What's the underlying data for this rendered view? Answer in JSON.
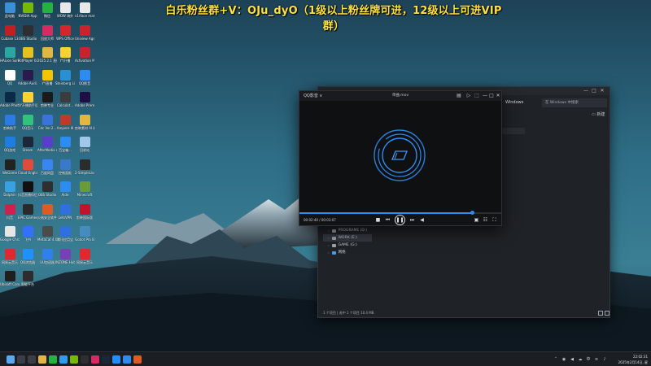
{
  "banner": {
    "text": "白乐粉丝群+V：OJu_dyO（1级以上粉丝牌可进，12级以上可进VIP群）"
  },
  "desktop": {
    "icons": [
      {
        "label": "此电脑",
        "icon": "computer-icon",
        "color": "#3b8ed8"
      },
      {
        "label": "NVIDIA App",
        "icon": "nvidia-icon",
        "color": "#76b900"
      },
      {
        "label": "微信",
        "icon": "wechat-icon",
        "color": "#24b33f"
      },
      {
        "label": "WOW 海外",
        "icon": "file-icon",
        "color": "#e8e8e8"
      },
      {
        "label": "v1rface makeup(1)...",
        "icon": "file-icon",
        "color": "#e8e8e8"
      },
      {
        "label": "Cubase 13",
        "icon": "cubase-icon",
        "color": "#c41e25"
      },
      {
        "label": "OBS Studio",
        "icon": "obs-icon",
        "color": "#302e31"
      },
      {
        "label": "回放大师",
        "icon": "replay-icon",
        "color": "#d62b62"
      },
      {
        "label": "WPS Office",
        "icon": "wps-icon",
        "color": "#d6262c"
      },
      {
        "label": "Uniview Agent 12.6",
        "icon": "uniview-icon",
        "color": "#c9242b"
      },
      {
        "label": "HALion Sonic",
        "icon": "halion-icon",
        "color": "#2ea6a0"
      },
      {
        "label": "PotPlayer 64 bit",
        "icon": "potplayer-icon",
        "color": "#e6c11c"
      },
      {
        "label": "2025.2.1 直播",
        "icon": "folder-icon",
        "color": "#e3b63f"
      },
      {
        "label": "YY开播",
        "icon": "yy-icon",
        "color": "#ffd230"
      },
      {
        "label": "Activation Manager",
        "icon": "activation-icon",
        "color": "#c8232c"
      },
      {
        "label": "QQ",
        "icon": "qq-icon",
        "color": "#ffffff"
      },
      {
        "label": "Adobe Audi...",
        "icon": "audition-icon",
        "color": "#2b1a4d"
      },
      {
        "label": "YY直播",
        "icon": "yy-live-icon",
        "color": "#f5c400"
      },
      {
        "label": "Steinberg Library ...",
        "icon": "steinberg-icon",
        "color": "#2b8fd3"
      },
      {
        "label": "QQ影音",
        "icon": "qq-player-icon",
        "color": "#2d8cf0"
      },
      {
        "label": "Adobe Photosh...",
        "icon": "photoshop-icon",
        "color": "#0b2a4a"
      },
      {
        "label": "YY开播助手设置",
        "icon": "yy-icon",
        "color": "#ffd230"
      },
      {
        "label": "剪映专业",
        "icon": "capcut-icon",
        "color": "#1a1a1a"
      },
      {
        "label": "Calculat...",
        "icon": "calculator-icon",
        "color": "#3c3c3c"
      },
      {
        "label": "Adobe Premie...",
        "icon": "premiere-icon",
        "color": "#1e1042"
      },
      {
        "label": "剪映助手",
        "icon": "kuaishou-icon",
        "color": "#2c7be5"
      },
      {
        "label": "QQ音乐",
        "icon": "qqmusic-icon",
        "color": "#31c27c"
      },
      {
        "label": "Cdc Ver.2...",
        "icon": "cdc-icon",
        "color": "#3a73d9"
      },
      {
        "label": "Ampere III",
        "icon": "ampere-icon",
        "color": "#c0392b"
      },
      {
        "label": "剪映素材 AI 精剪完成",
        "icon": "folder-icon",
        "color": "#e3b63f"
      },
      {
        "label": "QQ游戏",
        "icon": "qqgame-icon",
        "color": "#1f7de0"
      },
      {
        "label": "Steam",
        "icon": "steam-icon",
        "color": "#1b2838"
      },
      {
        "label": "AfterMedia AI Lan...",
        "icon": "aftermedia-icon",
        "color": "#5b3ec8"
      },
      {
        "label": "百宝箱...",
        "icon": "baobao-icon",
        "color": "#2d8cf0"
      },
      {
        "label": "回收站",
        "icon": "recycle-bin-icon",
        "color": "#9ec7ea"
      },
      {
        "label": "WeGame",
        "icon": "wegame-icon",
        "color": "#222222"
      },
      {
        "label": "Cloud English",
        "icon": "cloud-english-icon",
        "color": "#e04b3b"
      },
      {
        "label": "百度网盘",
        "icon": "baidu-netdisk-icon",
        "color": "#3a86f0"
      },
      {
        "label": "控制面板",
        "icon": "control-panel-icon",
        "color": "#3a78c9"
      },
      {
        "label": "2-SimpleLive",
        "icon": "simplelive-icon",
        "color": "#2c2c2c"
      },
      {
        "label": "Dolphin",
        "icon": "dolphin-icon",
        "color": "#3aa0e0"
      },
      {
        "label": "抖音直播伴侣",
        "icon": "douyin-icon",
        "color": "#111111"
      },
      {
        "label": "OBS Studio",
        "icon": "obs-icon",
        "color": "#302e31"
      },
      {
        "label": "Aide",
        "icon": "aide-icon",
        "color": "#2d8cf0"
      },
      {
        "label": "Minecraft",
        "icon": "minecraft-icon",
        "color": "#6a9b3b"
      },
      {
        "label": "抖音",
        "icon": "douyin-icon",
        "color": "#d02050"
      },
      {
        "label": "EPIC Games Launcher",
        "icon": "epic-icon",
        "color": "#2a2a2a"
      },
      {
        "label": "火绒安全软件",
        "icon": "huorong-icon",
        "color": "#e05a23"
      },
      {
        "label": "LetsVPN",
        "icon": "letsvpn-icon",
        "color": "#2f6fe0"
      },
      {
        "label": "剪映国际版",
        "icon": "capcut-icon",
        "color": "#c0142a"
      },
      {
        "label": "Google Chrome",
        "icon": "chrome-icon",
        "color": "#e6e6e6"
      },
      {
        "label": "飞书",
        "icon": "feishu-icon",
        "color": "#3370ff"
      },
      {
        "label": "MetaCat 4.0",
        "icon": "metacat-icon",
        "color": "#4b4b4b"
      },
      {
        "label": "腾讯应用宝",
        "icon": "tencent-icon",
        "color": "#2f6fe0"
      },
      {
        "label": "Godot Pro B",
        "icon": "godot-icon",
        "color": "#478cbf"
      },
      {
        "label": "网易云音乐",
        "icon": "neteasemusic-icon",
        "color": "#e0292c"
      },
      {
        "label": "QQ浏览器",
        "icon": "qqbrowser-icon",
        "color": "#1e90ff"
      },
      {
        "label": "UU加速器",
        "icon": "uu-icon",
        "color": "#2f80ed"
      },
      {
        "label": "INZONE Hub",
        "icon": "inzone-icon",
        "color": "#7b3fb5"
      },
      {
        "label": "网易云音乐",
        "icon": "neteasemusic-icon",
        "color": "#e0292c"
      },
      {
        "label": "Ubisoft Connect",
        "icon": "ubisoft-icon",
        "color": "#1f1f1f"
      },
      {
        "label": "智能平台",
        "icon": "platform-icon",
        "color": "#2d2d2d"
      }
    ]
  },
  "file_manager": {
    "address": "Windows",
    "search_placeholder": "在 Windows 中搜索",
    "new_folder": "新建",
    "drives": [
      {
        "label": "PROGRAME (D:)",
        "selected": false
      },
      {
        "label": "WORK (E:)",
        "selected": true
      },
      {
        "label": "GAME (G:)",
        "selected": false
      },
      {
        "label": "网络",
        "selected": false
      }
    ],
    "status": "1 个项目 | 选中 1 个项目  10.4 MB"
  },
  "player": {
    "app_name": "QQ影音 ∨",
    "file_name": "单曲.mov",
    "time": "00:02:40 / 00:03:07",
    "progress": 0.8556,
    "accent": "#2d8cf0"
  },
  "taskbar": {
    "time": "22:02:31",
    "date": "2025年2月14日, 星期五",
    "icons": [
      {
        "name": "start-icon",
        "color": "#5aa9f0"
      },
      {
        "name": "search-icon",
        "color": "#3b3f45"
      },
      {
        "name": "taskview-icon",
        "color": "#3b3f45"
      },
      {
        "name": "file-explorer-icon",
        "color": "#e3b63f"
      },
      {
        "name": "wechat-icon",
        "color": "#24b33f"
      },
      {
        "name": "qq-icon",
        "color": "#2c9cf0"
      },
      {
        "name": "nvidia-icon",
        "color": "#76b900"
      },
      {
        "name": "obs-icon",
        "color": "#302e31"
      },
      {
        "name": "replay-icon",
        "color": "#d62b62"
      },
      {
        "name": "steam-icon",
        "color": "#1b2838"
      },
      {
        "name": "qqbrowser-icon",
        "color": "#1e90ff"
      },
      {
        "name": "qq-player-icon",
        "color": "#2d8cf0"
      },
      {
        "name": "app-icon",
        "color": "#e05a23"
      }
    ]
  }
}
